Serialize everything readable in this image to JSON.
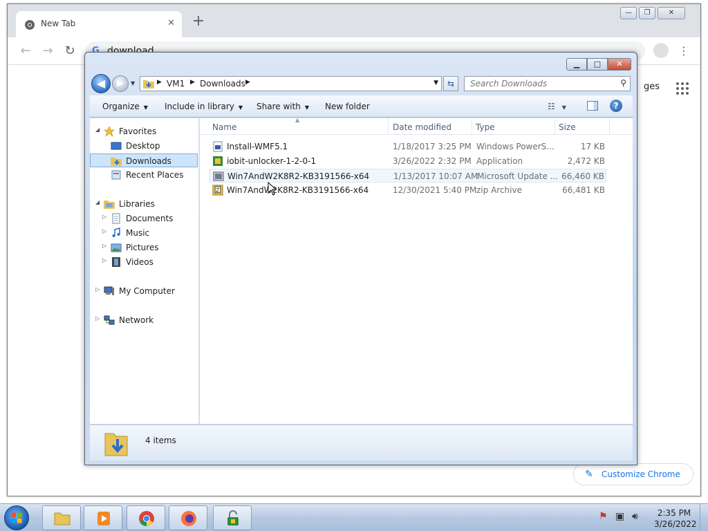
{
  "chrome": {
    "tab_title": "New Tab",
    "tab_close": "✕",
    "new_tab": "+",
    "address": "download",
    "caption": {
      "min": "—",
      "max": "❐",
      "close": "✕"
    },
    "back": "←",
    "forward": "→",
    "reload": "↻",
    "menu": "⋮",
    "images_link": "ges",
    "customize_label": "Customize Chrome",
    "customize_icon": "✎"
  },
  "explorer": {
    "caption": {
      "min": "▁",
      "max": "□",
      "close": "✕"
    },
    "back": "◀",
    "forward": "▶",
    "breadcrumb": [
      "VM1",
      "Downloads"
    ],
    "refresh": "⇆",
    "search_placeholder": "Search Downloads",
    "search_icon": "⚲",
    "toolbar": {
      "organize": "Organize",
      "include": "Include in library",
      "share": "Share with",
      "new_folder": "New folder",
      "help": "?"
    },
    "nav": {
      "favorites": "Favorites",
      "desktop": "Desktop",
      "downloads": "Downloads",
      "recent": "Recent Places",
      "libraries": "Libraries",
      "documents": "Documents",
      "music": "Music",
      "pictures": "Pictures",
      "videos": "Videos",
      "computer": "My Computer",
      "network": "Network"
    },
    "columns": {
      "name": "Name",
      "date": "Date modified",
      "type": "Type",
      "size": "Size"
    },
    "files": [
      {
        "name": "Install-WMF5.1",
        "date": "1/18/2017 3:25 PM",
        "type": "Windows PowerS...",
        "size": "17 KB",
        "icon": "powershell-script-icon"
      },
      {
        "name": "iobit-unlocker-1-2-0-1",
        "date": "3/26/2022 2:32 PM",
        "type": "Application",
        "size": "2,472 KB",
        "icon": "application-icon"
      },
      {
        "name": "Win7AndW2K8R2-KB3191566-x64",
        "date": "1/13/2017 10:07 AM",
        "type": "Microsoft Update ...",
        "size": "66,460 KB",
        "icon": "msu-package-icon"
      },
      {
        "name": "Win7AndW2K8R2-KB3191566-x64",
        "date": "12/30/2021 5:40 PM",
        "type": "zip Archive",
        "size": "66,481 KB",
        "icon": "zip-archive-icon"
      }
    ],
    "item_count": "4 items"
  },
  "taskbar": {
    "time": "2:35 PM",
    "date": "3/26/2022",
    "apps": [
      "windows-explorer",
      "media-player",
      "google-chrome",
      "firefox",
      "iobit-unlocker"
    ]
  },
  "colors": {
    "chrome_accent": "#1a73e8",
    "selection": "#cde5fb",
    "explorer_frame": "#c3d5ee"
  }
}
